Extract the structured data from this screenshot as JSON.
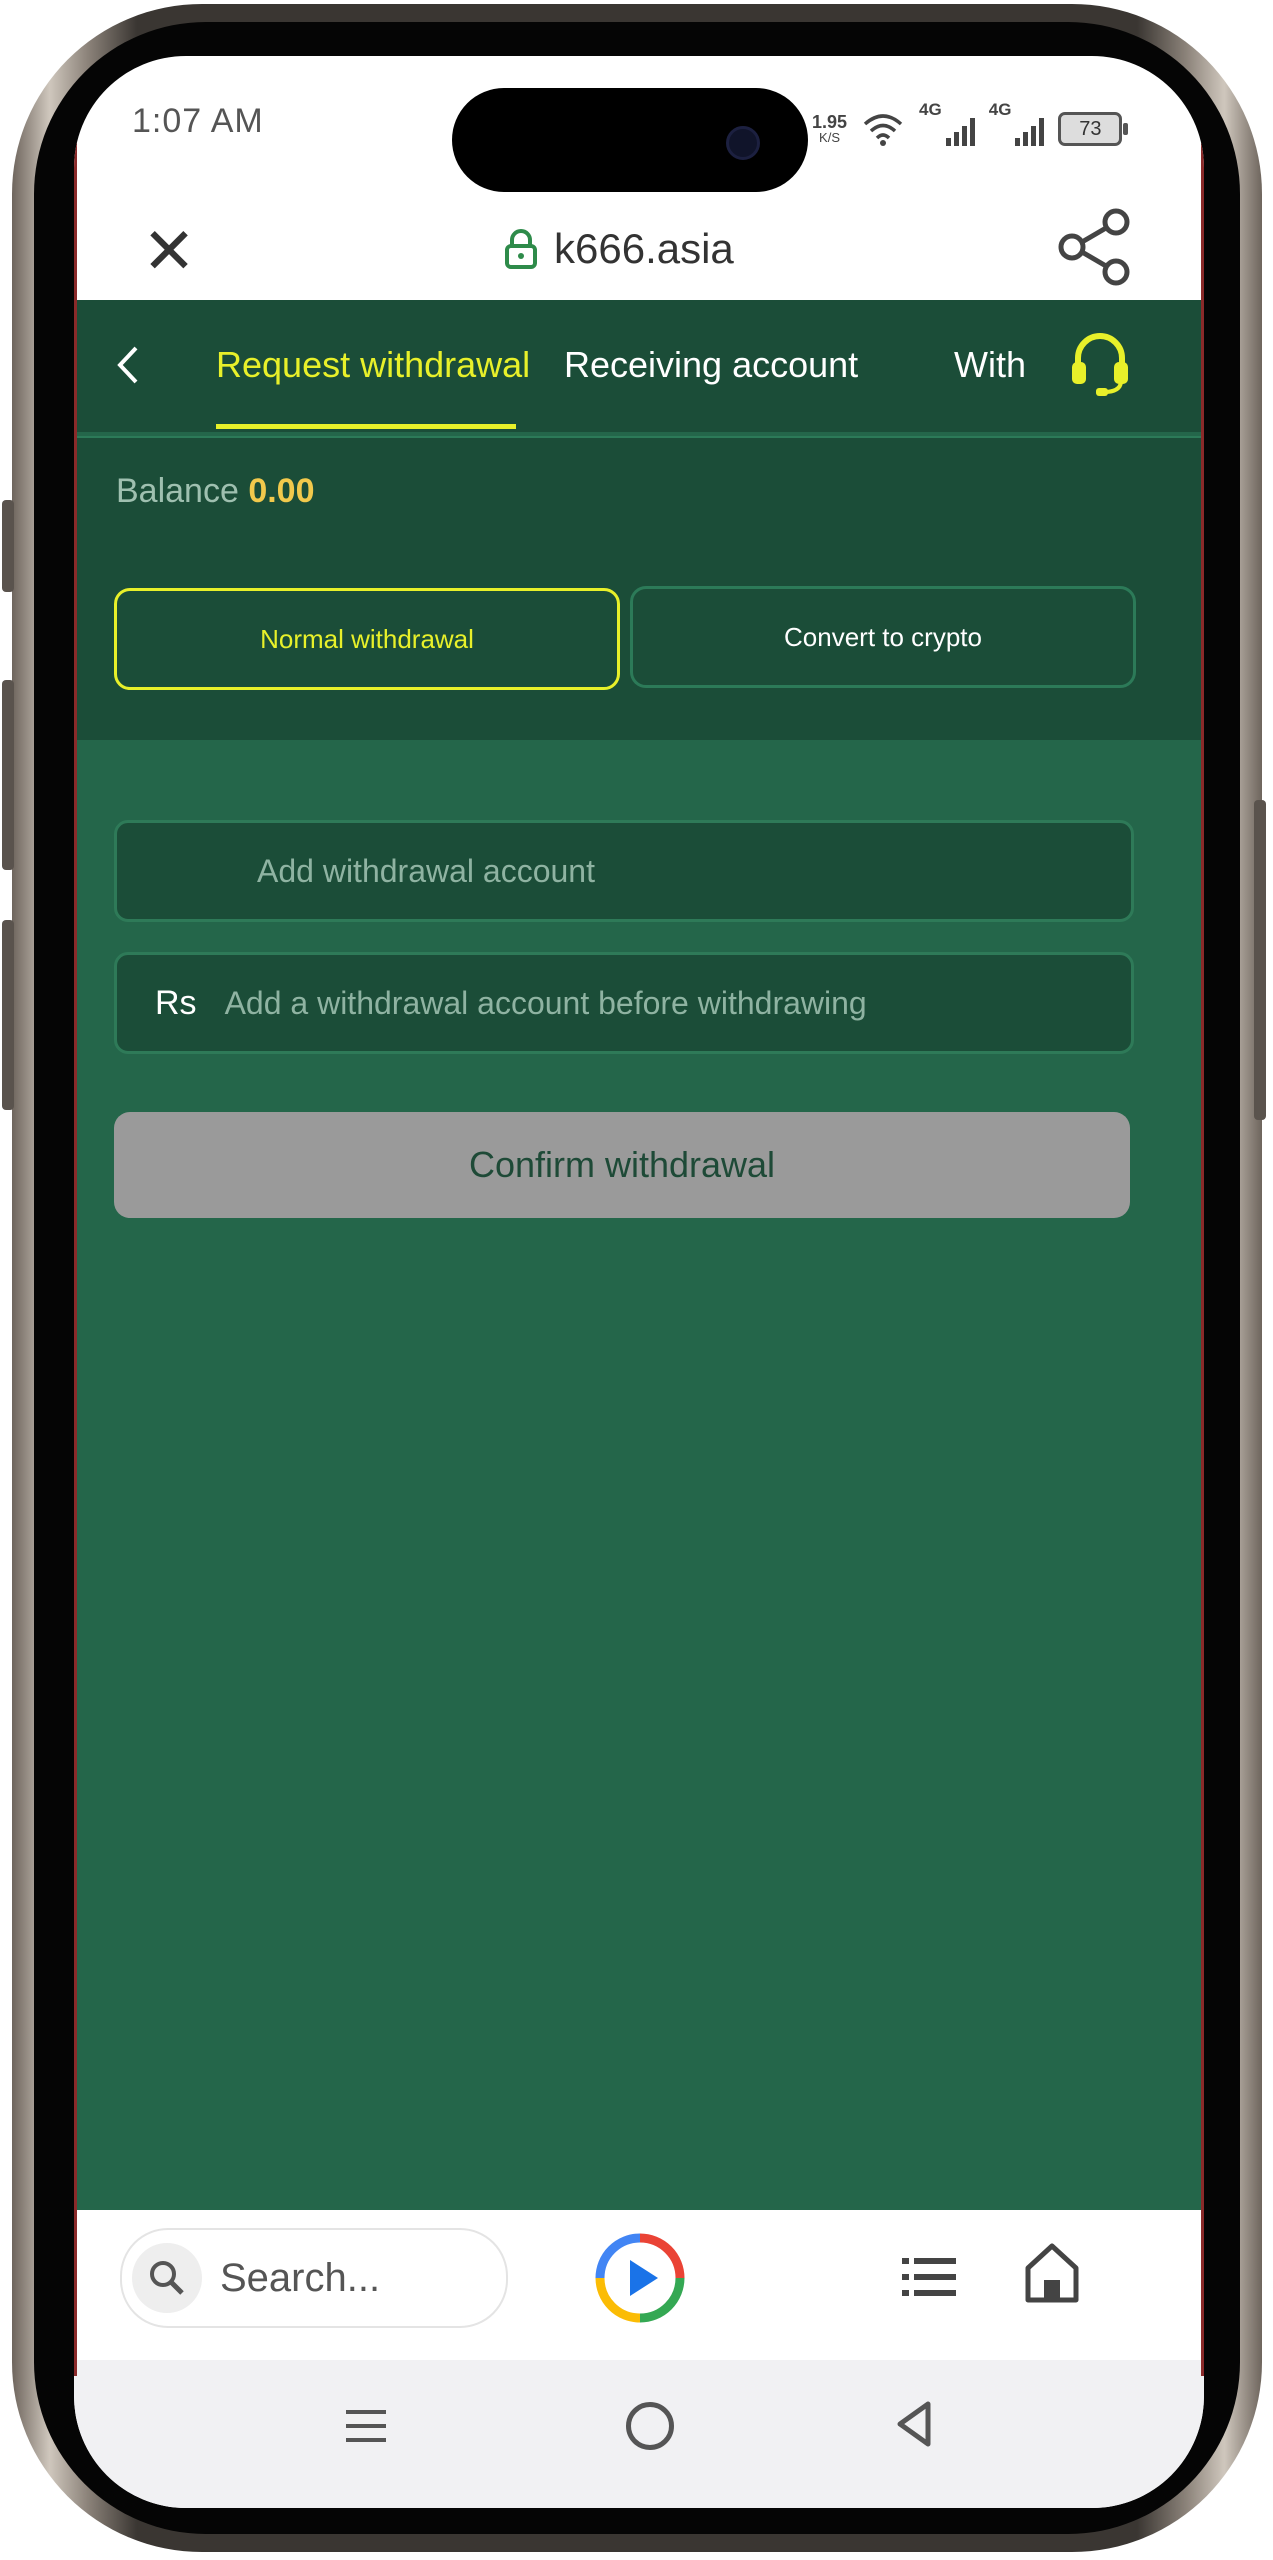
{
  "status_bar": {
    "time": "1:07 AM",
    "net_speed": "1.95",
    "net_unit": "K/S",
    "signal1": "4G",
    "signal2": "4G",
    "battery": "73"
  },
  "browser": {
    "url": "k666.asia",
    "close_icon": "close-icon",
    "lock_icon": "lock-icon",
    "share_icon": "share-icon"
  },
  "nav": {
    "tabs": [
      {
        "label": "Request withdrawal",
        "active": true
      },
      {
        "label": "Receiving account",
        "active": false
      },
      {
        "label": "With",
        "active": false
      }
    ],
    "back_icon": "chevron-left-icon",
    "support_icon": "headset-icon"
  },
  "balance": {
    "label": "Balance",
    "value": "0.00"
  },
  "modes": {
    "normal": "Normal withdrawal",
    "crypto": "Convert to crypto"
  },
  "form": {
    "account_placeholder": "Add withdrawal account",
    "currency": "Rs",
    "amount_placeholder": "Add a withdrawal account before withdrawing",
    "confirm_label": "Confirm withdrawal"
  },
  "toolbar": {
    "search_placeholder": "Search...",
    "search_icon": "search-icon",
    "play_icon": "play-logo-icon",
    "list_icon": "list-icon",
    "home_icon": "home-icon"
  },
  "colors": {
    "app_bg": "#24664a",
    "header_bg": "#1b4d38",
    "accent_yellow": "#e8f02a",
    "balance_gold": "#f2c94c",
    "disabled_button": "#9a9a9a"
  }
}
